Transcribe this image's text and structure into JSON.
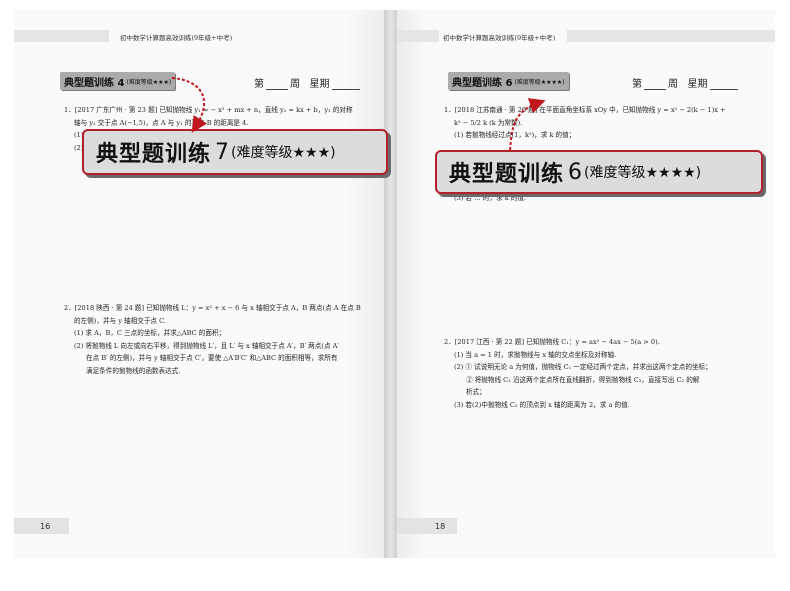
{
  "left_page": {
    "running_head": "初中数学计算题高效训练(9年级+中考)",
    "tab_title": "典型题训练 4",
    "tab_level": "(难度等级★★★)",
    "week_label": "第",
    "week_unit": "周",
    "weekday_label": "星期",
    "problem1": {
      "line1": "1．[2017 广东广州 · 第 23 题] 已知抛物线 y₁ = − x² + mx + n，直线 y₂ = kx + b，y₁ 的对称",
      "line2": "轴与 y₂ 交于点 A(−1,5)，点 A 与 y₁ 的顶点 B 的距离是 4.",
      "line3": "(1)",
      "line4": "(2)"
    },
    "problem2": {
      "line1": "2．[2018 陕西 · 第 24 题] 已知抛物线 L：y = x² + x − 6 与 x 轴相交于点 A，B 两点(点 A 在点 B",
      "line2": "的左侧)，并与 y 轴相交于点 C.",
      "line3": "(1) 求 A，B，C 三点的坐标，并求△ABC 的面积；",
      "line4": "(2) 将抛物线 L 向左或向右平移，得到抛物线 L′，且 L′ 与 x 轴相交于点 A′，B′ 两点(点 A′",
      "line5": "在点 B′ 的左侧)，并与 y 轴相交于点 C′，要使 △A′B′C′ 和△ABC 的面积相等，求所有",
      "line6": "满足条件的抛物线的函数表达式."
    },
    "page_number": "16"
  },
  "right_page": {
    "running_head": "初中数学计算题高效训练(9年级+中考)",
    "tab_title": "典型题训练 6",
    "tab_level": "(难度等级★★★★)",
    "week_label": "第",
    "week_unit": "周",
    "weekday_label": "星期",
    "problem1": {
      "line1": "1．[2018 江苏南通 · 第 26 题] 在平面直角坐标系 xOy 中，已知抛物线 y = x² − 2(k − 1)x +",
      "line2": "k² − 5/2 k (k 为常数).",
      "line3": "(1) 若抛物线经过点(1，k²)，求 k 的值；",
      "line4": "",
      "line5": "；",
      "line6": "(3) 若 … 时，求 k 的值."
    },
    "problem2": {
      "line1": "2．[2017 江西 · 第 22 题] 已知抛物线 C₁：y = ax² − 4ax − 5(a > 0).",
      "line2": "(1) 当 a = 1 时，求抛物线与 x 轴的交点坐标及对称轴.",
      "line3": "(2) ① 试说明无论 a 为何值，抛物线 C₁ 一定经过两个定点，并求出这两个定点的坐标；",
      "line4": "② 将抛物线 C₁ 沿这两个定点所在直线翻折，得到抛物线 C₂，直接写出 C₂ 的解",
      "line5": "析式；",
      "line6": "(3) 若(2)中抛物线 C₂ 的顶点到 x 轴的距离为 2，求 a 的值."
    },
    "page_number": "18"
  },
  "callout_left": {
    "title": "典型题训练",
    "number": "7",
    "level": "(难度等级★★★)"
  },
  "callout_right": {
    "title": "典型题训练",
    "number": "6",
    "level": "(难度等级★★★★)"
  },
  "colors": {
    "callout_border": "#b3202a",
    "arrow": "#c0181f",
    "tab_bg": "#ababab"
  }
}
